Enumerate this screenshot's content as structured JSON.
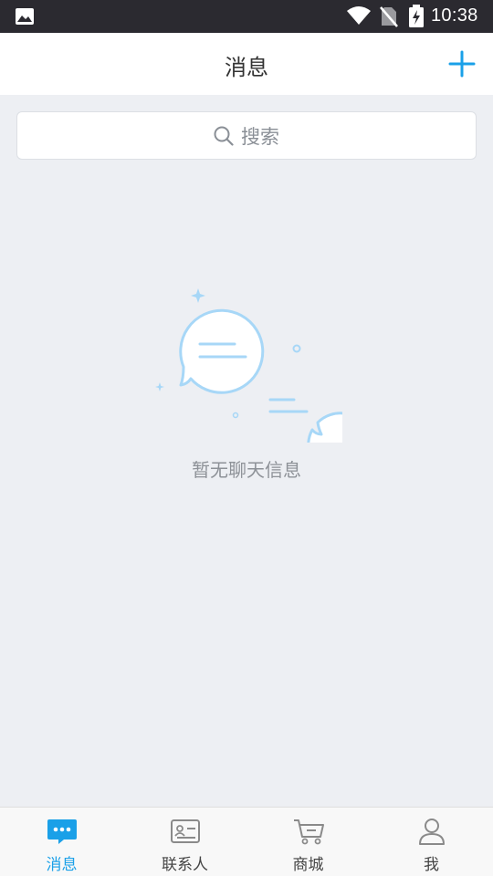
{
  "status_bar": {
    "time": "10:38"
  },
  "header": {
    "title": "消息"
  },
  "search": {
    "placeholder": "搜索"
  },
  "empty_state": {
    "message": "暂无聊天信息"
  },
  "tabs": [
    {
      "label": "消息",
      "icon": "chat-bubble-icon",
      "active": true
    },
    {
      "label": "联系人",
      "icon": "contact-card-icon",
      "active": false
    },
    {
      "label": "商城",
      "icon": "shopping-cart-icon",
      "active": false
    },
    {
      "label": "我",
      "icon": "person-icon",
      "active": false
    }
  ],
  "colors": {
    "accent": "#1aa0e8",
    "status_bar": "#2b2a30",
    "background": "#edeff3",
    "illustration": "#a7d7f7"
  }
}
